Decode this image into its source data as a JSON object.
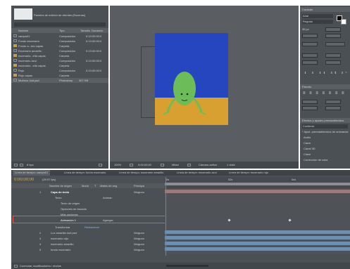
{
  "project": {
    "title": "Paneles de edición de clientes (Escenas)",
    "columns": [
      "Nombre",
      "Tipo",
      "Tamaño",
      "Duración"
    ],
    "items": [
      {
        "name": "campo01",
        "type": "Composición",
        "dur": "0:13:00:00:0"
      },
      {
        "name": "Fondo escenario",
        "type": "Composición",
        "dur": "0:13:00:00:0"
      },
      {
        "name": "Fondo a...tos capas",
        "type": "Carpeta",
        "dur": ""
      },
      {
        "name": "Escenario amarillo",
        "type": "Composición",
        "dur": "0:13:00:00:0"
      },
      {
        "name": "escenario...ella capas",
        "type": "Carpeta",
        "dur": ""
      },
      {
        "name": "escenario azul",
        "type": "Composición",
        "dur": "0:13:00:00:0"
      },
      {
        "name": "escenario...ella capas",
        "type": "Carpeta",
        "dur": ""
      },
      {
        "name": "Rojo",
        "type": "Composición",
        "dur": "0:13:00:00:0"
      },
      {
        "name": "Rojo capas",
        "type": "Carpeta",
        "dur": ""
      },
      {
        "name": "Muñeco dud.psd",
        "type": "Photoshop",
        "dur": "307 KB"
      }
    ],
    "footer": "8 bpc"
  },
  "viewer": {
    "zoom": "100%",
    "timecode": "0;00;00;00",
    "quality": "Mitad",
    "camera": "Cámara activa",
    "views": "1 vista"
  },
  "character_panel": {
    "title": "Carácter",
    "font": "Arial",
    "style": "Regular",
    "size": "36 px",
    "units": "px"
  },
  "paragraph_panel": {
    "title": "Párrafo"
  },
  "effects_panel": {
    "title": "Efectos y ajustes preestablecidos",
    "search": "Contiene:",
    "items": [
      "* Ajust. preestablecidos de animación",
      "Audio",
      "Canal",
      "Canal 3D",
      "Clave",
      "Corrección de color"
    ]
  },
  "timeline": {
    "tabs": [
      "Línea de tiempo: campo01",
      "Línea de tiempo: fondo escenario",
      "Línea de tiempo: escenario amarillo",
      "Línea de tiempo: escenario azul",
      "Línea de tiempo: escenario rojo"
    ],
    "timecode": "0;00;00;00",
    "fps": "(29.97 fps)",
    "col_headers": [
      "Nombre de origen",
      "Modo",
      "T",
      "Mates de seg.",
      "Principal"
    ],
    "ruler": [
      "0s",
      "02s",
      "04s"
    ],
    "layers": [
      {
        "num": "1",
        "name": "Capa de texto",
        "mode": "",
        "parent": "Ninguno",
        "bold": true
      },
      {
        "label": "Texto",
        "extra": "Animar:",
        "indent": 1
      },
      {
        "label": "Texto de origen",
        "indent": 2
      },
      {
        "label": "Opciones de trazado",
        "indent": 2
      },
      {
        "label": "Más opciones",
        "indent": 2
      },
      {
        "label": "Animación 1",
        "extra": "Agregar:",
        "indent": 2,
        "highlight": true
      },
      {
        "label": "Transformar",
        "extra": "Restablecer",
        "indent": 1
      },
      {
        "num": "2",
        "name": "Luz amarilla dud.psd",
        "parent": "Ninguno"
      },
      {
        "num": "3",
        "name": "escenario rojo",
        "parent": "Ninguno"
      },
      {
        "num": "4",
        "name": "escenario amarillo",
        "parent": "Ninguno"
      },
      {
        "num": "5",
        "name": "fondo escenario",
        "parent": "Ninguno"
      }
    ],
    "footer_left": "Conmutar modificadores / modos"
  },
  "colors": {
    "sky": "#2646c0",
    "ground": "#d8a030",
    "figure": "#6cbc5a",
    "panel": "#4b5054",
    "highlight": "#e8554a",
    "track": "#6e8fb0"
  }
}
